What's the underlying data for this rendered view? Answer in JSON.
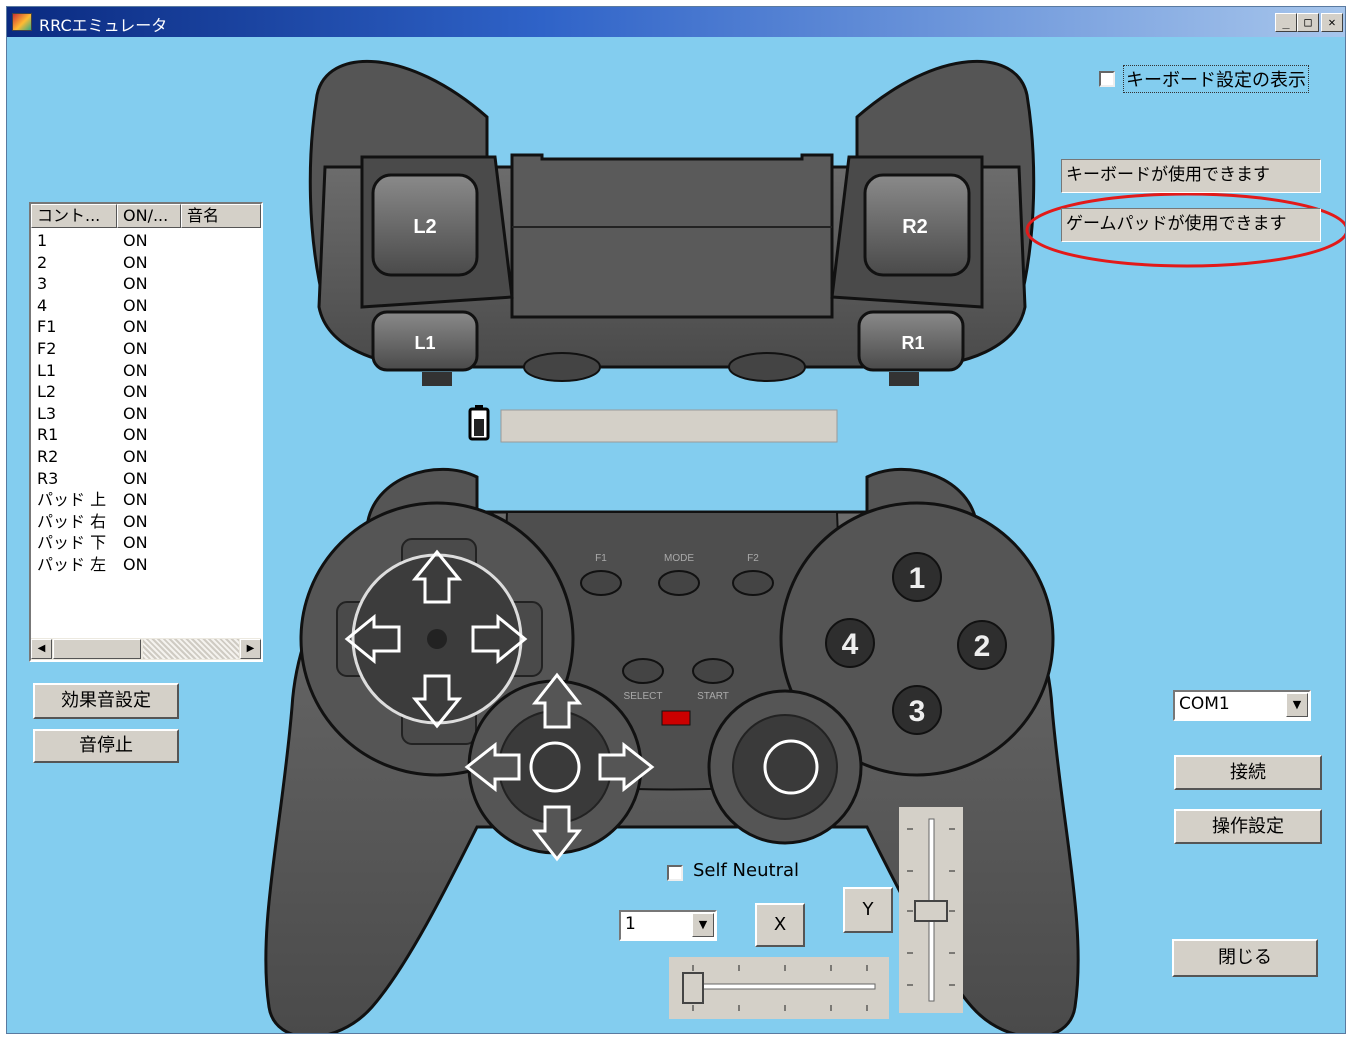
{
  "window": {
    "title": "RRCエミュレータ",
    "minimize": "_",
    "maximize": "□",
    "close": "✕"
  },
  "options": {
    "keyboard_settings_label": "キーボード設定の表示",
    "keyboard_settings_checked": false
  },
  "status": {
    "keyboard": "キーボードが使用できます",
    "gamepad": "ゲームパッドが使用できます"
  },
  "sound_list": {
    "columns": [
      "コント...",
      "ON/...",
      "音名"
    ],
    "rows": [
      [
        "1",
        "ON"
      ],
      [
        "2",
        "ON"
      ],
      [
        "3",
        "ON"
      ],
      [
        "4",
        "ON"
      ],
      [
        "F1",
        "ON"
      ],
      [
        "F2",
        "ON"
      ],
      [
        "L1",
        "ON"
      ],
      [
        "L2",
        "ON"
      ],
      [
        "L3",
        "ON"
      ],
      [
        "R1",
        "ON"
      ],
      [
        "R2",
        "ON"
      ],
      [
        "R3",
        "ON"
      ],
      [
        "パッド 上",
        "ON"
      ],
      [
        "パッド 右",
        "ON"
      ],
      [
        "パッド 下",
        "ON"
      ],
      [
        "パッド 左",
        "ON"
      ]
    ]
  },
  "buttons": {
    "sound_effects": "効果音設定",
    "stop_sound": "音停止",
    "connect": "接続",
    "control_settings": "操作設定",
    "close": "閉じる",
    "x": "X",
    "y": "Y"
  },
  "port": {
    "selected": "COM1"
  },
  "self_neutral": {
    "label": "Self Neutral",
    "checked": false
  },
  "axis_select": {
    "selected": "1"
  },
  "gamepad": {
    "shoulder": {
      "l2": "L2",
      "r2": "R2",
      "l1": "L1",
      "r1": "R1"
    },
    "small_buttons": {
      "f1": "F1",
      "mode": "MODE",
      "f2": "F2",
      "select": "SELECT",
      "start": "START"
    },
    "face": {
      "b1": "1",
      "b2": "2",
      "b3": "3",
      "b4": "4"
    }
  },
  "colors": {
    "window_bg": "#83cdef",
    "pad_body": "#5e5e5e",
    "pad_dark": "#3c3c3c",
    "highlight_circle": "#e21a1a",
    "led": "#cc0000"
  }
}
